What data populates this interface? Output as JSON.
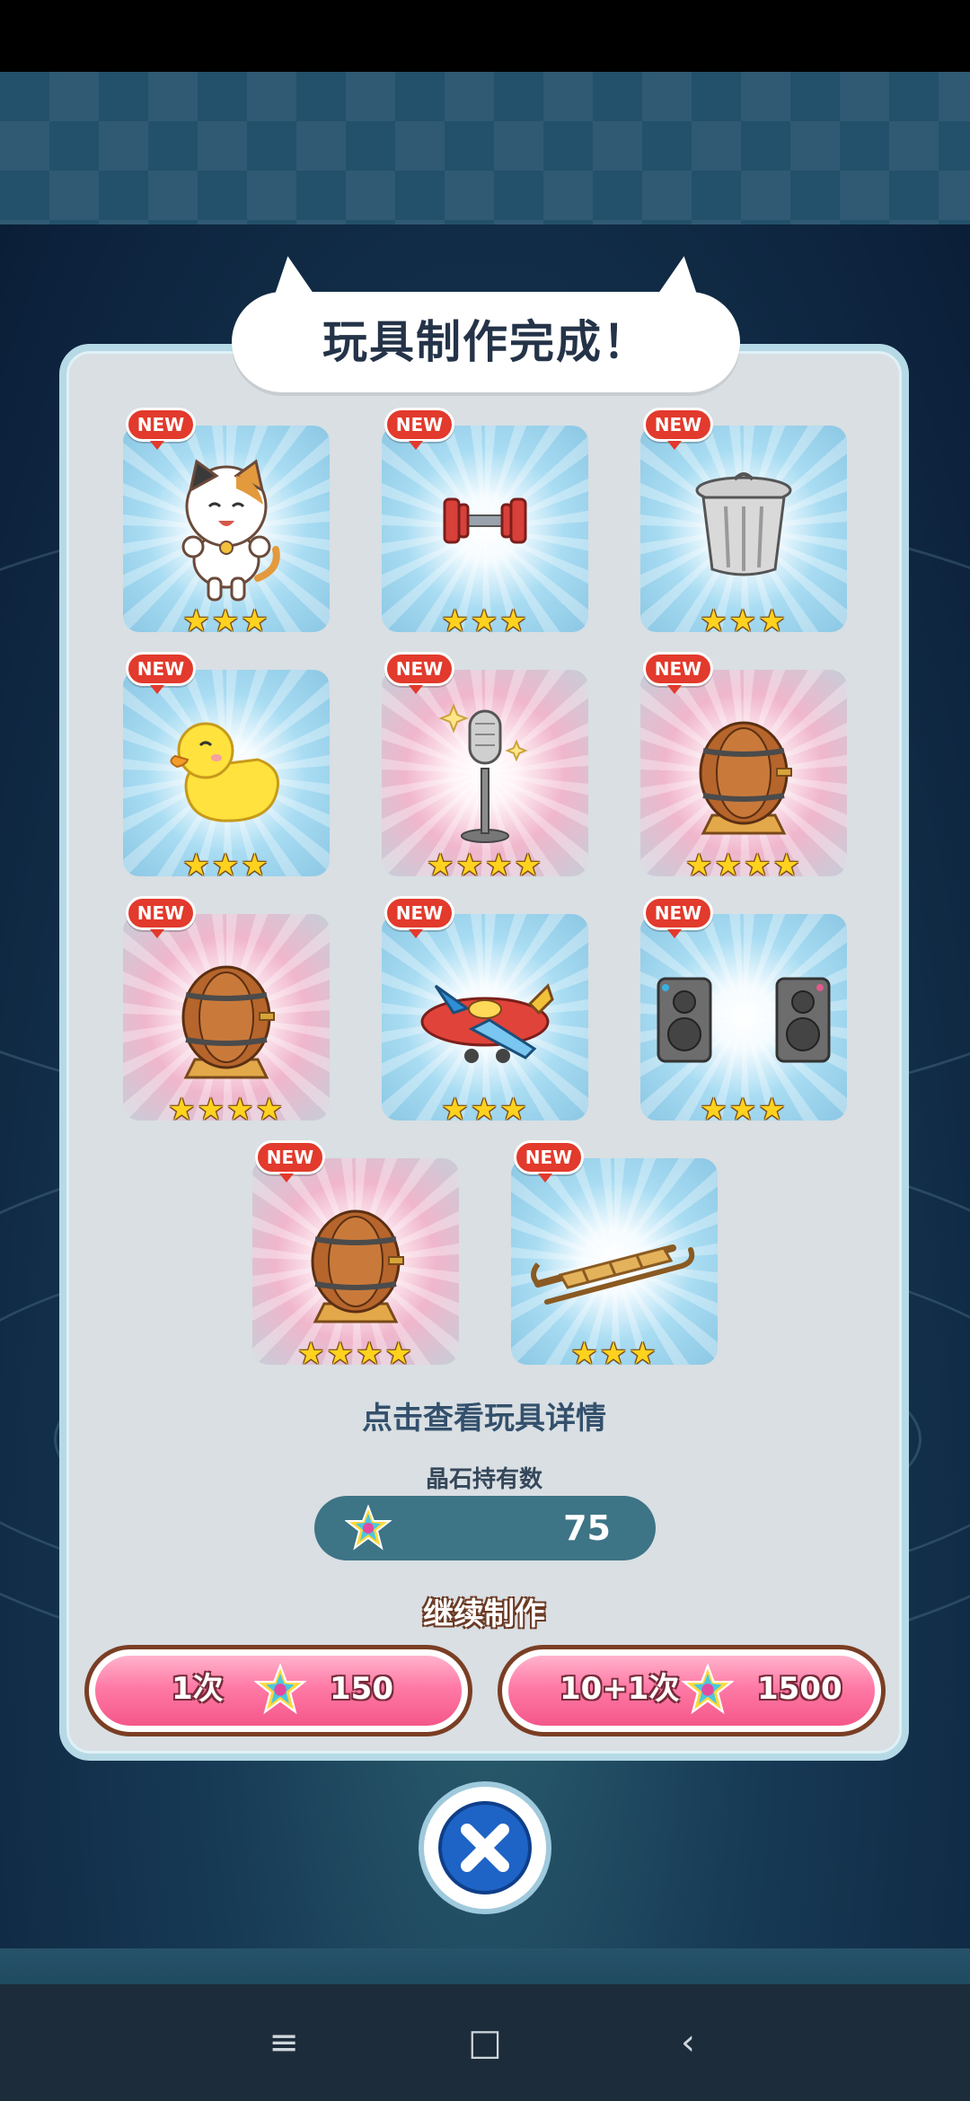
{
  "dialog": {
    "title": "玩具制作完成！",
    "hint": "点击查看玩具详情",
    "gem_label": "晶石持有数",
    "gem_count": "75",
    "continue_label": "继续制作",
    "buttons": [
      {
        "label": "1次",
        "cost": "150"
      },
      {
        "label": "10+1次",
        "cost": "1500"
      }
    ]
  },
  "new_badge": "NEW",
  "toys": [
    {
      "name": "calico-cat",
      "stars": 3,
      "glow": "blue"
    },
    {
      "name": "dumbbell",
      "stars": 3,
      "glow": "blue"
    },
    {
      "name": "trash-can",
      "stars": 3,
      "glow": "blue"
    },
    {
      "name": "rubber-duck",
      "stars": 3,
      "glow": "blue"
    },
    {
      "name": "microphone",
      "stars": 4,
      "glow": "pink"
    },
    {
      "name": "barrel",
      "stars": 4,
      "glow": "pink"
    },
    {
      "name": "barrel",
      "stars": 4,
      "glow": "pink"
    },
    {
      "name": "toy-airplane",
      "stars": 3,
      "glow": "blue"
    },
    {
      "name": "speakers",
      "stars": 3,
      "glow": "blue"
    },
    {
      "name": "barrel",
      "stars": 4,
      "glow": "pink"
    },
    {
      "name": "sled",
      "stars": 3,
      "glow": "blue"
    }
  ],
  "nav": {
    "menu_icon": "≡",
    "home_icon": "□",
    "back_icon": "‹"
  },
  "colors": {
    "accent_pink": "#f4578a",
    "panel": "#d9dfe3",
    "title_text": "#243348"
  }
}
